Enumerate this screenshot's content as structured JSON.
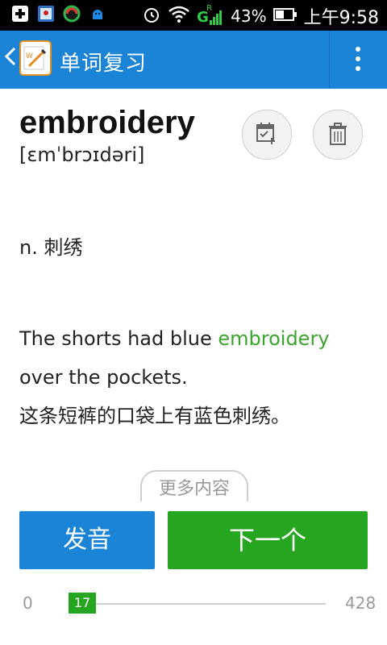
{
  "status_bar": {
    "signal_label": "G",
    "signal_sub": "R",
    "battery_percent": "43%",
    "time": "上午9:58",
    "left_icons": [
      "add-icon",
      "photo-icon",
      "sync-icon",
      "android-icon"
    ],
    "right_icons": [
      "alarm-icon",
      "wifi-icon",
      "signal-icon",
      "battery-icon"
    ]
  },
  "app_bar": {
    "title": "单词复习",
    "back_icon": "back-arrow-icon",
    "logo_icon": "app-logo-icon",
    "menu_icon": "overflow-menu-icon"
  },
  "card": {
    "word": "embroidery",
    "phonetic": "[ɛmˈbrɔɪdəri]",
    "meaning": "n. 刺绣",
    "example_prefix": "The shorts had blue ",
    "example_keyword": "embroidery",
    "example_suffix": " over the pockets.",
    "example_translation": "这条短裤的口袋上有蓝色刺绣。",
    "more_content": "更多内容"
  },
  "actions": {
    "pronounce_label": "发音",
    "next_label": "下一个"
  },
  "progress": {
    "min": "0",
    "current": "17",
    "max": "428",
    "fraction": 0.0397
  },
  "colors": {
    "primary_blue": "#1b84d6",
    "primary_green": "#26a521",
    "highlight_green": "#3aa52b"
  }
}
